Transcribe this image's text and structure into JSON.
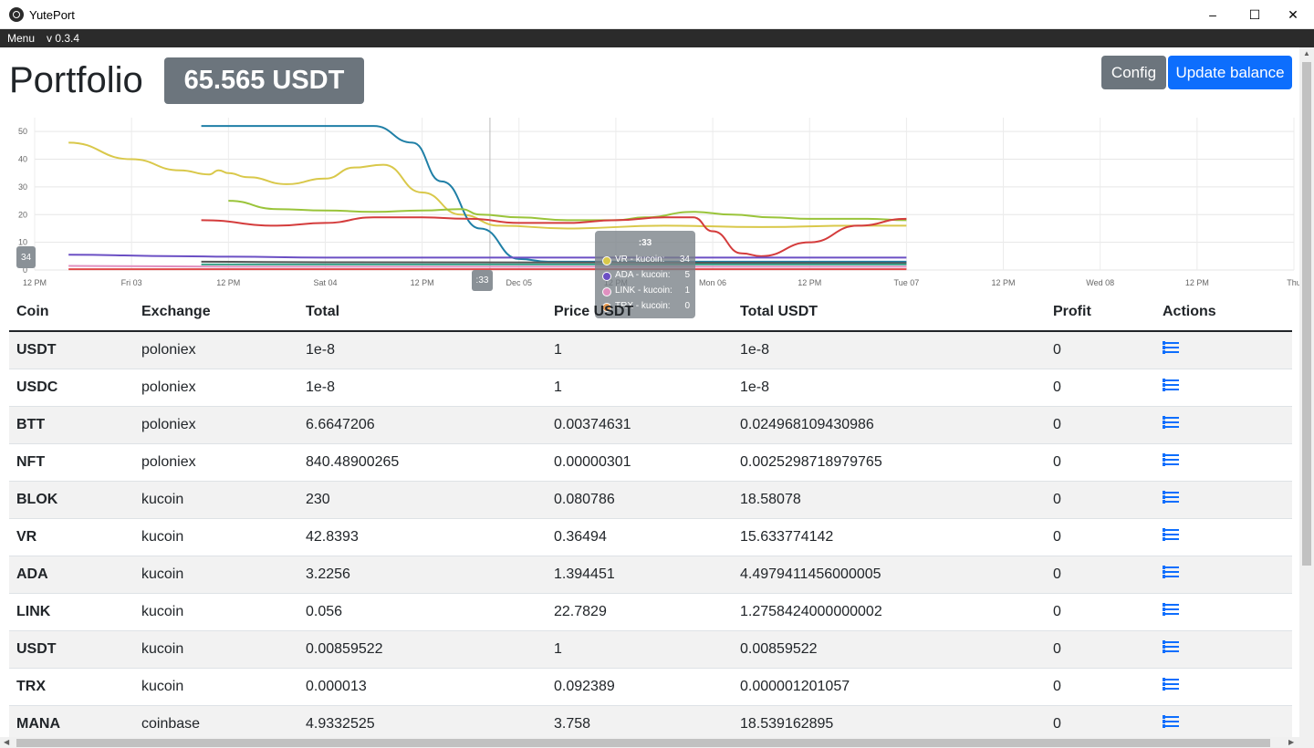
{
  "window": {
    "title": "YutePort"
  },
  "menubar": {
    "menu_label": "Menu",
    "version": "v 0.3.4"
  },
  "header": {
    "title": "Portfolio",
    "balance": "65.565 USDT",
    "config_label": "Config",
    "update_label": "Update balance"
  },
  "chart_data": {
    "type": "line",
    "x_tick_labels": [
      "12 PM",
      "Fri 03",
      "12 PM",
      "Sat 04",
      "12 PM",
      "Dec 05",
      "12 PM",
      "Mon 06",
      "12 PM",
      "Tue 07",
      "12 PM",
      "Wed 08",
      "12 PM",
      "Thu"
    ],
    "y_ticks": [
      0,
      10,
      20,
      30,
      40,
      50
    ],
    "ylim": [
      0,
      55
    ],
    "grid": true,
    "series": [
      {
        "color": "#d9c84a",
        "points": [
          [
            0.35,
            46
          ],
          [
            1.0,
            40
          ],
          [
            1.5,
            36
          ],
          [
            1.8,
            34.5
          ],
          [
            1.9,
            36
          ],
          [
            2.0,
            35
          ],
          [
            2.2,
            33.5
          ],
          [
            2.6,
            31
          ],
          [
            3.0,
            33
          ],
          [
            3.3,
            37
          ],
          [
            3.6,
            38
          ],
          [
            4.0,
            28
          ],
          [
            4.4,
            20
          ],
          [
            4.8,
            16
          ],
          [
            5.5,
            15
          ],
          [
            6.5,
            16
          ],
          [
            7.5,
            15.5
          ],
          [
            8.5,
            16
          ],
          [
            9.0,
            16
          ]
        ]
      },
      {
        "color": "#1f7fa6",
        "points": [
          [
            1.72,
            52
          ],
          [
            2.6,
            52
          ],
          [
            3.5,
            52
          ],
          [
            3.9,
            46
          ],
          [
            4.2,
            32
          ],
          [
            4.6,
            15
          ],
          [
            5.0,
            4
          ],
          [
            5.3,
            3
          ],
          [
            6.5,
            3
          ],
          [
            8.0,
            3
          ],
          [
            9.0,
            3
          ]
        ]
      },
      {
        "color": "#9ac43a",
        "points": [
          [
            2.0,
            25
          ],
          [
            2.5,
            22
          ],
          [
            3.0,
            21.5
          ],
          [
            3.5,
            21
          ],
          [
            4.0,
            21.5
          ],
          [
            4.4,
            22
          ],
          [
            4.6,
            20
          ],
          [
            5.0,
            19
          ],
          [
            5.5,
            18
          ],
          [
            6.0,
            18
          ],
          [
            6.3,
            19
          ],
          [
            6.8,
            21
          ],
          [
            7.2,
            20
          ],
          [
            7.6,
            19
          ],
          [
            8.0,
            18.5
          ],
          [
            8.6,
            18.5
          ],
          [
            9.0,
            18
          ]
        ]
      },
      {
        "color": "#d43c3c",
        "points": [
          [
            1.72,
            18
          ],
          [
            2.5,
            16
          ],
          [
            3.0,
            17
          ],
          [
            3.5,
            19
          ],
          [
            4.0,
            19
          ],
          [
            4.5,
            18.5
          ],
          [
            5.0,
            17
          ],
          [
            5.5,
            17
          ],
          [
            6.0,
            18
          ],
          [
            6.5,
            19
          ],
          [
            6.8,
            19
          ],
          [
            7.0,
            14
          ],
          [
            7.3,
            6
          ],
          [
            7.5,
            5
          ],
          [
            8.0,
            10
          ],
          [
            8.5,
            16
          ],
          [
            9.0,
            18.5
          ]
        ]
      },
      {
        "color": "#6b4fc4",
        "points": [
          [
            0.35,
            5.5
          ],
          [
            1.5,
            5
          ],
          [
            2.0,
            4.8
          ],
          [
            3.0,
            4.5
          ],
          [
            5.0,
            4.5
          ],
          [
            7.0,
            4.5
          ],
          [
            9.0,
            4.5
          ]
        ]
      },
      {
        "color": "#555555",
        "points": [
          [
            1.72,
            3
          ],
          [
            3.0,
            2.8
          ],
          [
            6.0,
            2.7
          ],
          [
            9.0,
            2.5
          ]
        ]
      },
      {
        "color": "#38a38a",
        "points": [
          [
            1.72,
            2
          ],
          [
            5.0,
            2
          ],
          [
            9.0,
            2
          ]
        ]
      },
      {
        "color": "#e090c0",
        "points": [
          [
            0.35,
            1.5
          ],
          [
            2.0,
            1.2
          ],
          [
            5.0,
            1.2
          ],
          [
            9.0,
            1.2
          ]
        ]
      },
      {
        "color": "#e04848",
        "points": [
          [
            0.35,
            0.3
          ],
          [
            4.0,
            0.3
          ],
          [
            9.0,
            0.3
          ]
        ]
      }
    ],
    "tooltip": {
      "title": ":33",
      "items": [
        {
          "label": "VR - kucoin:",
          "value": "34",
          "color": "#d9c84a"
        },
        {
          "label": "ADA - kucoin:",
          "value": "5",
          "color": "#6b4fc4"
        },
        {
          "label": "LINK - kucoin:",
          "value": "1",
          "color": "#e090c0"
        },
        {
          "label": "TRX - kucoin:",
          "value": "0",
          "color": "#e89a50"
        }
      ]
    },
    "crosshair_x_label": ":33",
    "crosshair_y_label": "34"
  },
  "table": {
    "headers": [
      "Coin",
      "Exchange",
      "Total",
      "Price USDT",
      "Total USDT",
      "Profit",
      "Actions"
    ],
    "rows": [
      {
        "coin": "USDT",
        "exchange": "poloniex",
        "total": "1e-8",
        "price": "1",
        "total_usdt": "1e-8",
        "profit": "0"
      },
      {
        "coin": "USDC",
        "exchange": "poloniex",
        "total": "1e-8",
        "price": "1",
        "total_usdt": "1e-8",
        "profit": "0"
      },
      {
        "coin": "BTT",
        "exchange": "poloniex",
        "total": "6.6647206",
        "price": "0.00374631",
        "total_usdt": "0.024968109430986",
        "profit": "0"
      },
      {
        "coin": "NFT",
        "exchange": "poloniex",
        "total": "840.48900265",
        "price": "0.00000301",
        "total_usdt": "0.0025298718979765",
        "profit": "0"
      },
      {
        "coin": "BLOK",
        "exchange": "kucoin",
        "total": "230",
        "price": "0.080786",
        "total_usdt": "18.58078",
        "profit": "0"
      },
      {
        "coin": "VR",
        "exchange": "kucoin",
        "total": "42.8393",
        "price": "0.36494",
        "total_usdt": "15.633774142",
        "profit": "0"
      },
      {
        "coin": "ADA",
        "exchange": "kucoin",
        "total": "3.2256",
        "price": "1.394451",
        "total_usdt": "4.4979411456000005",
        "profit": "0"
      },
      {
        "coin": "LINK",
        "exchange": "kucoin",
        "total": "0.056",
        "price": "22.7829",
        "total_usdt": "1.2758424000000002",
        "profit": "0"
      },
      {
        "coin": "USDT",
        "exchange": "kucoin",
        "total": "0.00859522",
        "price": "1",
        "total_usdt": "0.00859522",
        "profit": "0"
      },
      {
        "coin": "TRX",
        "exchange": "kucoin",
        "total": "0.000013",
        "price": "0.092389",
        "total_usdt": "0.000001201057",
        "profit": "0"
      },
      {
        "coin": "MANA",
        "exchange": "coinbase",
        "total": "4.9332525",
        "price": "3.758",
        "total_usdt": "18.539162895",
        "profit": "0"
      }
    ]
  }
}
